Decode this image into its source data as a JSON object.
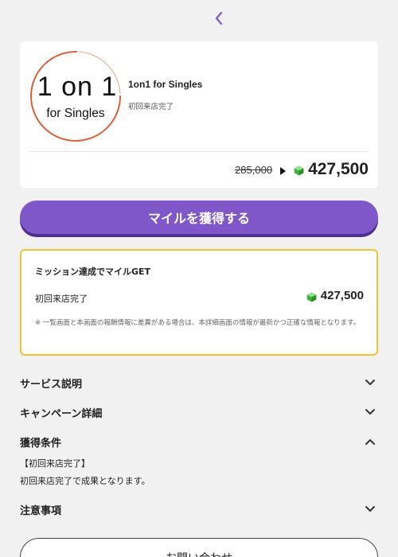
{
  "offer": {
    "logo_line1": "1 on 1",
    "logo_line2": "for Singles",
    "title": "1on1 for Singles",
    "subtitle": "初回来店完了",
    "old_price": "285,000",
    "new_price": "427,500"
  },
  "cta_label": "マイルを獲得する",
  "mission": {
    "heading": "ミッション達成でマイルGET",
    "item_label": "初回来店完了",
    "reward": "427,500",
    "note": "※ 一覧画面と本画面の報酬情報に差異がある場合は、本詳細画面の情報が最新かつ正確な情報となります。"
  },
  "sections": [
    {
      "title": "サービス説明",
      "expanded": false
    },
    {
      "title": "キャンペーン詳細",
      "expanded": false
    },
    {
      "title": "獲得条件",
      "expanded": true,
      "lines": [
        "【初回来店完了】",
        "初回来店完了で成果となります。"
      ]
    },
    {
      "title": "注意事項",
      "expanded": false
    }
  ],
  "contact_label": "お問い合わせ",
  "colors": {
    "accent": "#7f57c8",
    "mission_border": "#f1c232",
    "logo_ring": "#d9603b",
    "gem": "#3fb53f"
  }
}
